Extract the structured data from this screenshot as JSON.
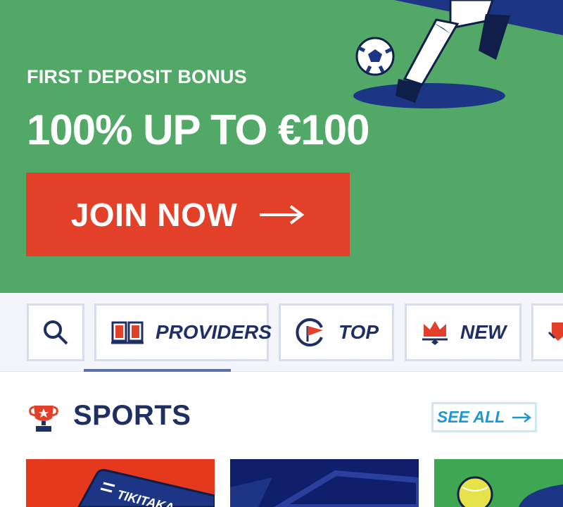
{
  "hero": {
    "subtitle": "FIRST DEPOSIT BONUS",
    "title": "100% UP TO €100",
    "cta_label": "JOIN NOW",
    "colors": {
      "background": "#52a866",
      "cta": "#e3402a"
    }
  },
  "categories": {
    "search_icon": "search-icon",
    "items": [
      {
        "label": "PROVIDERS",
        "icon": "book-icon"
      },
      {
        "label": "TOP",
        "icon": "flag-icon"
      },
      {
        "label": "NEW",
        "icon": "crown-icon"
      },
      {
        "label": "",
        "icon": "badge-icon"
      }
    ],
    "active_index": 0
  },
  "sports": {
    "title": "SPORTS",
    "see_all_label": "SEE ALL",
    "icon": "trophy-icon",
    "tiles": [
      {
        "brand": "TIKITAKA",
        "color": "#e5391d"
      },
      {
        "brand": "",
        "color": "#0f1f6b"
      },
      {
        "brand": "",
        "color": "#3fa653"
      }
    ]
  }
}
